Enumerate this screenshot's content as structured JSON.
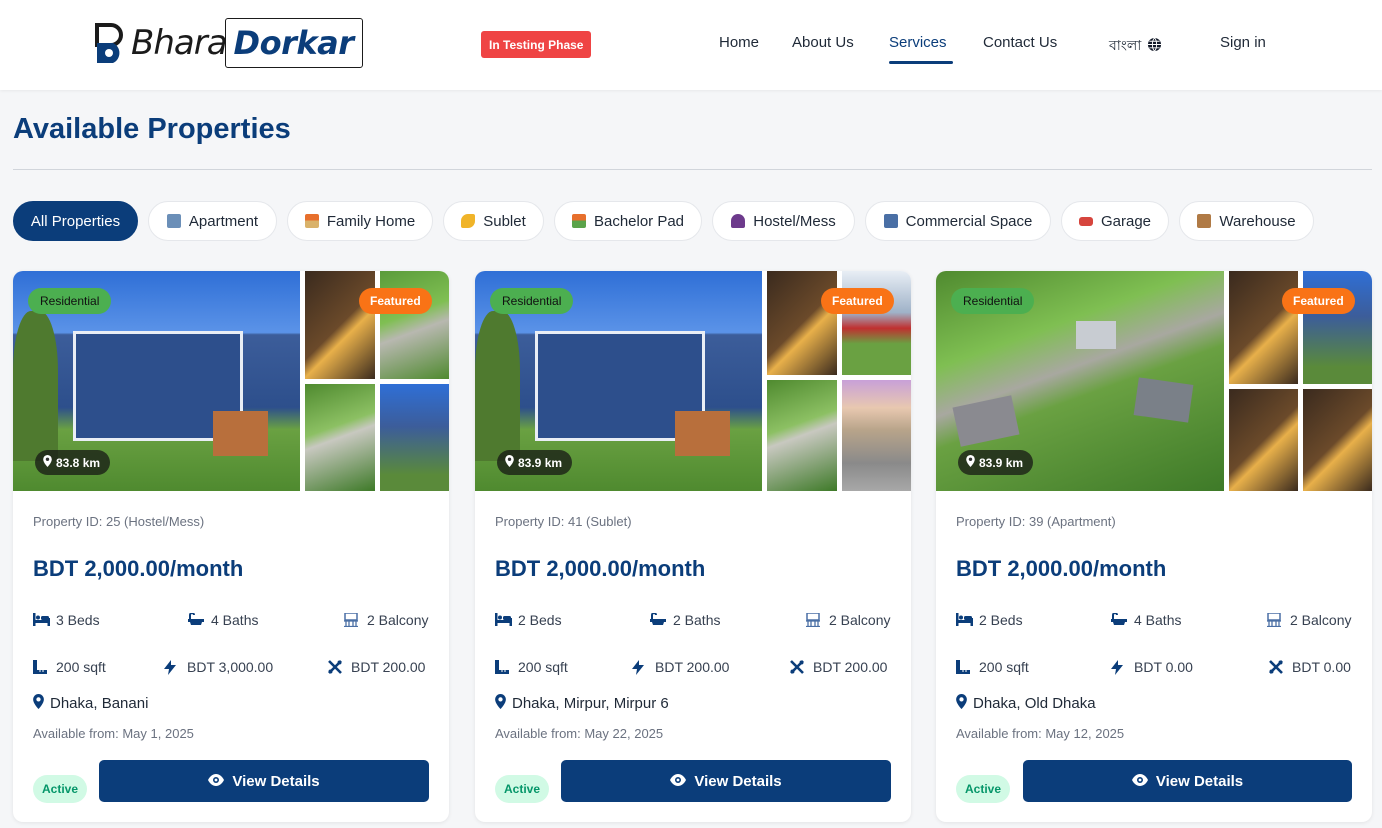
{
  "header": {
    "logo_text_1": "Bhara",
    "logo_text_2": "Dorkar",
    "testing_badge": "In Testing Phase",
    "nav": [
      {
        "label": "Home"
      },
      {
        "label": "About Us"
      },
      {
        "label": "Services"
      },
      {
        "label": "Contact Us"
      }
    ],
    "language": "বাংলা",
    "sign_in": "Sign in"
  },
  "page_title": "Available Properties",
  "filters": [
    {
      "label": "All Properties",
      "icon": "",
      "active": true
    },
    {
      "label": "Apartment",
      "icon": "building-icon",
      "active": false
    },
    {
      "label": "Family Home",
      "icon": "house-icon",
      "active": false
    },
    {
      "label": "Sublet",
      "icon": "key-icon",
      "active": false
    },
    {
      "label": "Bachelor Pad",
      "icon": "house-garden-icon",
      "active": false
    },
    {
      "label": "Hostel/Mess",
      "icon": "people-icon",
      "active": false
    },
    {
      "label": "Commercial Space",
      "icon": "office-icon",
      "active": false
    },
    {
      "label": "Garage",
      "icon": "car-icon",
      "active": false
    },
    {
      "label": "Warehouse",
      "icon": "box-icon",
      "active": false
    }
  ],
  "cards": [
    {
      "tag": "Residential",
      "featured": "Featured",
      "distance": "83.8 km",
      "property_id": "Property ID: 25 (Hostel/Mess)",
      "price": "BDT 2,000.00/month",
      "beds": "3 Beds",
      "baths": "4 Baths",
      "balcony": "2 Balcony",
      "size": "200 sqft",
      "electricity": "BDT 3,000.00",
      "service": "BDT 200.00",
      "location": "Dhaka, Banani",
      "available": "Available from: May 1, 2025",
      "status": "Active",
      "button": "View Details"
    },
    {
      "tag": "Residential",
      "featured": "Featured",
      "distance": "83.9 km",
      "property_id": "Property ID: 41 (Sublet)",
      "price": "BDT 2,000.00/month",
      "beds": "2 Beds",
      "baths": "2 Baths",
      "balcony": "2 Balcony",
      "size": "200 sqft",
      "electricity": "BDT 200.00",
      "service": "BDT 200.00",
      "location": "Dhaka, Mirpur, Mirpur 6",
      "available": "Available from: May 22, 2025",
      "status": "Active",
      "button": "View Details"
    },
    {
      "tag": "Residential",
      "featured": "Featured",
      "distance": "83.9 km",
      "property_id": "Property ID: 39 (Apartment)",
      "price": "BDT 2,000.00/month",
      "beds": "2 Beds",
      "baths": "4 Baths",
      "balcony": "2 Balcony",
      "size": "200 sqft",
      "electricity": "BDT 0.00",
      "service": "BDT 0.00",
      "location": "Dhaka, Old Dhaka",
      "available": "Available from: May 12, 2025",
      "status": "Active",
      "button": "View Details"
    }
  ],
  "colors": {
    "primary": "#0b3d7a",
    "residential_tag": "#4caf50",
    "featured_tag": "#f97316",
    "testing_badge": "#ef4444",
    "active_status_bg": "#d1fae5",
    "active_status_text": "#059669"
  }
}
